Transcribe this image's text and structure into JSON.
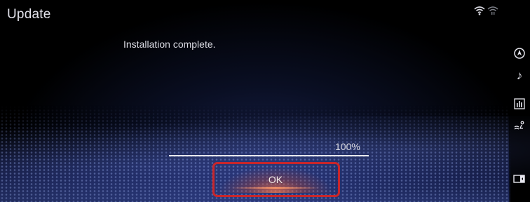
{
  "window": {
    "title": "Update"
  },
  "status": {
    "icons": [
      "wifi-icon",
      "signal-icon"
    ]
  },
  "message": "Installation complete.",
  "progress": {
    "label": "100%",
    "value": 1.0
  },
  "ok_button": {
    "label": "OK"
  },
  "rail": {
    "icons": [
      "navigation-icon",
      "music-note-icon",
      "equalizer-icon",
      "climate-icon",
      "screen-toggle-icon"
    ]
  },
  "colors": {
    "highlight_border": "#c8262b",
    "button_glow": "#ff7846",
    "background": "#000000",
    "mesh": "#3c50aa"
  }
}
